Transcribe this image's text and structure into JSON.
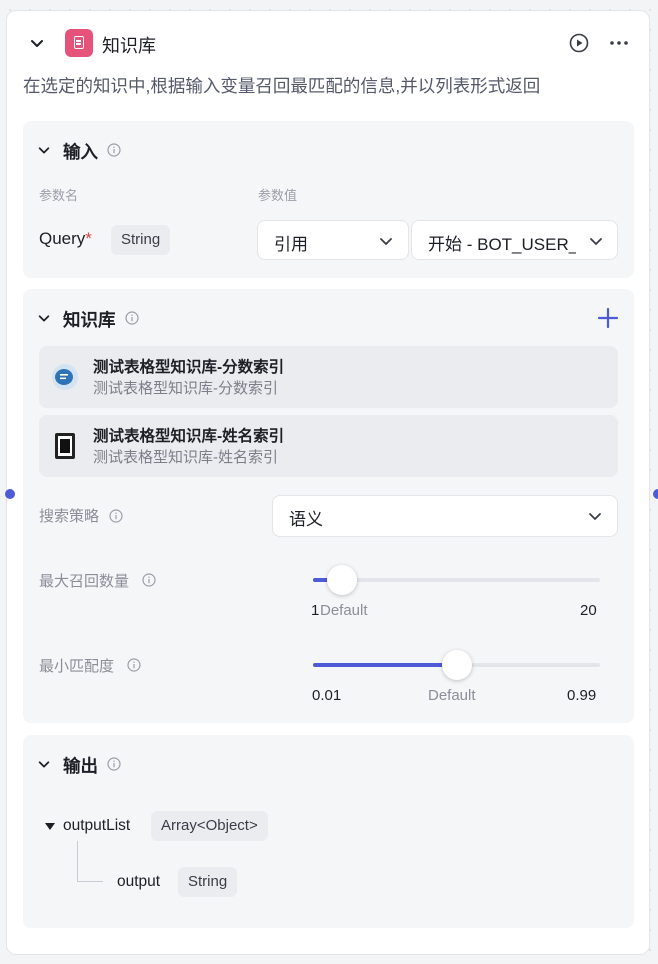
{
  "node": {
    "title": "知识库",
    "description": "在选定的知识中,根据输入变量召回最匹配的信息,并以列表形式返回"
  },
  "input": {
    "title": "输入",
    "col_name": "参数名",
    "col_value": "参数值",
    "param_name": "Query",
    "required_mark": "*",
    "param_type": "String",
    "ref_select": "引用",
    "var_select": "开始 - BOT_USER_INPUT"
  },
  "knowledge": {
    "title": "知识库",
    "items": [
      {
        "name": "测试表格型知识库-分数索引",
        "sub": "测试表格型知识库-分数索引"
      },
      {
        "name": "测试表格型知识库-姓名索引",
        "sub": "测试表格型知识库-姓名索引"
      }
    ],
    "strategy_label": "搜索策略",
    "strategy_value": "语义",
    "max_label": "最大召回数量",
    "max_slider": {
      "min": "1",
      "default_label": "Default",
      "max": "20",
      "value": 1
    },
    "min_label": "最小匹配度",
    "min_slider": {
      "min": "0.01",
      "default_label": "Default",
      "max": "0.99",
      "value": 0.5
    }
  },
  "output": {
    "title": "输出",
    "root_name": "outputList",
    "root_type": "Array<Object>",
    "child_name": "output",
    "child_type": "String"
  },
  "colors": {
    "accent": "#4e5bd6",
    "node_icon": "#e5537b",
    "required": "#e03f3f"
  }
}
